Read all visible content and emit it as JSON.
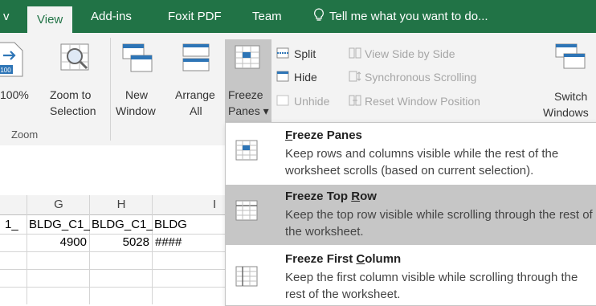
{
  "tabs": {
    "partial": "v",
    "view": "View",
    "addins": "Add-ins",
    "foxit": "Foxit PDF",
    "team": "Team",
    "tell_me": "Tell me what you want to do..."
  },
  "ribbon": {
    "zoom100_label": "100%",
    "zoom100_icon_text": "100",
    "zoom_to_selection": [
      "Zoom to",
      "Selection"
    ],
    "group_zoom": "Zoom",
    "new_window": [
      "New",
      "Window"
    ],
    "arrange_all": [
      "Arrange",
      "All"
    ],
    "freeze_panes": [
      "Freeze",
      "Panes ▾"
    ],
    "split": "Split",
    "hide": "Hide",
    "unhide": "Unhide",
    "view_side_by_side": "View Side by Side",
    "sync_scrolling": "Synchronous Scrolling",
    "reset_window_position": "Reset Window Position",
    "switch_windows": [
      "Switch",
      "Windows"
    ]
  },
  "sheet": {
    "col_headers": [
      "G",
      "H",
      "I"
    ],
    "row1": [
      "1_",
      "BLDG_C1_",
      "BLDG_C1_",
      "BLDG"
    ],
    "row2": [
      "4900",
      "5028",
      "####"
    ]
  },
  "menu": {
    "items": [
      {
        "pre": "",
        "u": "F",
        "post": "reeze Panes",
        "desc": "Keep rows and columns visible while the rest of the worksheet scrolls (based on current selection)."
      },
      {
        "pre": "Freeze Top ",
        "u": "R",
        "post": "ow",
        "desc": "Keep the top row visible while scrolling through the rest of the worksheet."
      },
      {
        "pre": "Freeze First ",
        "u": "C",
        "post": "olumn",
        "desc": "Keep the first column visible while scrolling through the rest of the worksheet."
      }
    ]
  },
  "colors": {
    "excel_green": "#217346",
    "ribbon_bg": "#f3f3f3",
    "highlight": "#c6c6c6"
  }
}
